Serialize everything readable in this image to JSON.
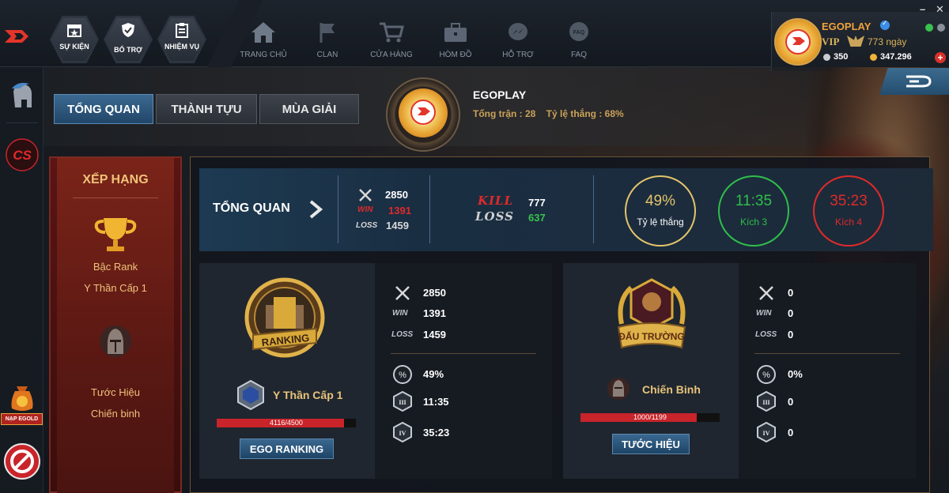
{
  "topbar": {
    "hex_buttons": [
      {
        "label": "SỰ KIỆN"
      },
      {
        "label": "BỔ TRỢ"
      },
      {
        "label": "NHIỆM VỤ"
      }
    ],
    "nav": [
      {
        "label": "TRANG CHỦ",
        "icon": "home-icon"
      },
      {
        "label": "CLAN",
        "icon": "flag-icon"
      },
      {
        "label": "CỬA HÀNG",
        "icon": "cart-icon"
      },
      {
        "label": "HÒM ĐỒ",
        "icon": "toolbox-icon"
      },
      {
        "label": "HỖ TRỢ",
        "icon": "messenger-icon"
      },
      {
        "label": "FAQ",
        "icon": "faq-icon"
      }
    ],
    "window_controls": {
      "minimize": "–",
      "close": "✕"
    }
  },
  "profile": {
    "name": "EGOPLAY",
    "vip_label": "VIP",
    "vip_days": "773 ngày",
    "silver": "350",
    "gold": "347.296",
    "add": "+"
  },
  "sidebar": {
    "nap_label": "NẠP EGOLD"
  },
  "tabs": [
    {
      "label": "TỔNG QUAN",
      "active": true
    },
    {
      "label": "THÀNH TỰU",
      "active": false
    },
    {
      "label": "MÙA GIẢI",
      "active": false
    }
  ],
  "header": {
    "name": "EGOPLAY",
    "stats": "Tổng trận : 28    Tỷ lệ thắng : 68%"
  },
  "rank_card": {
    "title": "XẾP HẠNG",
    "rank_label": "Bậc Rank",
    "rank_value": "Y Thần Cấp 1",
    "title_label": "Tước Hiệu",
    "title_value": "Chiến binh"
  },
  "summary": {
    "title": "TỔNG QUAN",
    "matches": "2850",
    "wins": "1391",
    "losses": "1459",
    "kill_label": "KILL",
    "loss_label": "LOSS",
    "kills": "777",
    "deaths": "637",
    "circles": [
      {
        "value": "49%",
        "caption": "Tỷ lệ thắng",
        "color": "#e3c46a"
      },
      {
        "value": "11:35",
        "caption": "Kích 3",
        "color": "#2fbf4a"
      },
      {
        "value": "35:23",
        "caption": "Kích 4",
        "color": "#e02a2a"
      }
    ],
    "win_word": "WIN",
    "loss_word": "LOSS"
  },
  "ranking_panel": {
    "emblem_text": "RANKING",
    "rank_name": "Y Thần Cấp 1",
    "progress_text": "4116/4500",
    "progress": 0.915,
    "button": "EGO RANKING",
    "stats": {
      "matches": "2850",
      "wins": "1391",
      "losses": "1459",
      "winrate": "49%",
      "k3": "11:35",
      "k4": "35:23"
    }
  },
  "arena_panel": {
    "emblem_text": "ĐẤU TRƯỜNG",
    "rank_name": "Chiến Binh",
    "progress_text": "1000/1199",
    "progress": 0.834,
    "button": "TƯỚC HIỆU",
    "stats": {
      "matches": "0",
      "wins": "0",
      "losses": "0",
      "winrate": "0%",
      "k3": "0",
      "k4": "0"
    }
  },
  "colors": {
    "accent": "#2b5a82",
    "gold": "#e8c37a",
    "red": "#c8242a"
  }
}
